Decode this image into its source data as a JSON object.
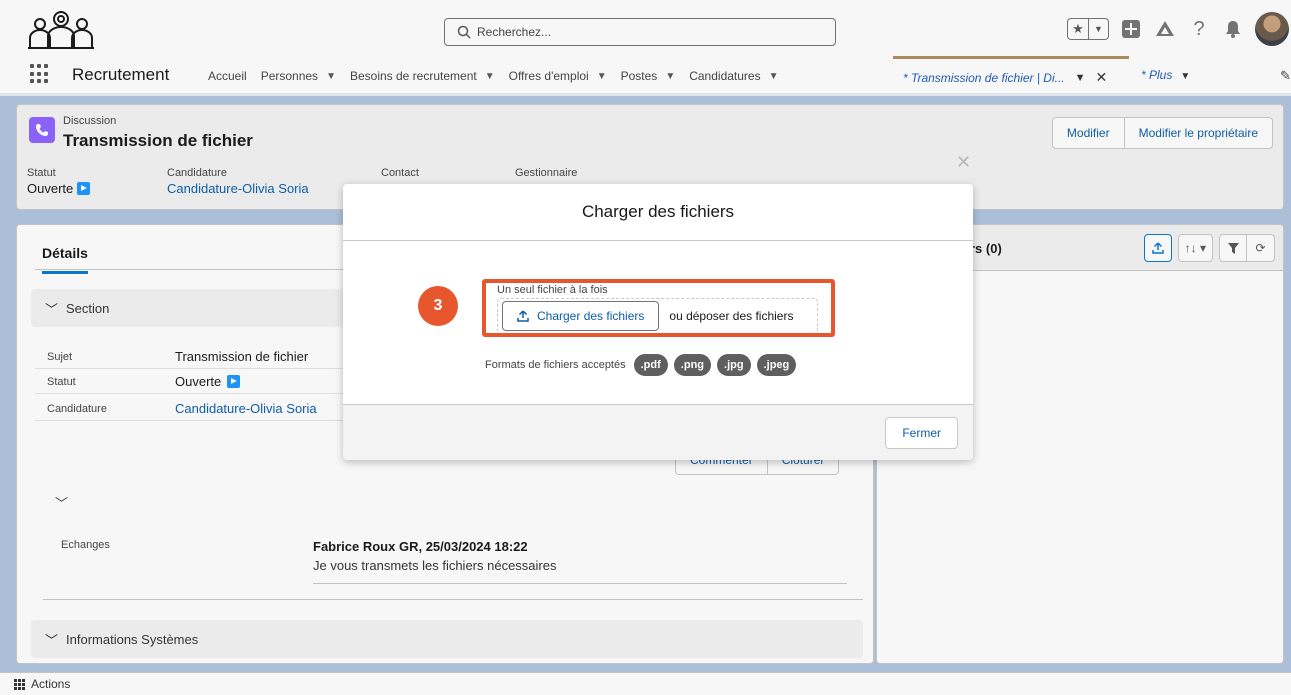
{
  "header": {
    "search_placeholder": "Recherchez..."
  },
  "nav": {
    "app_name": "Recrutement",
    "items": [
      {
        "label": "Accueil",
        "has_menu": false
      },
      {
        "label": "Personnes",
        "has_menu": true
      },
      {
        "label": "Besoins de recrutement",
        "has_menu": true
      },
      {
        "label": "Offres d'emploi",
        "has_menu": true
      },
      {
        "label": "Postes",
        "has_menu": true
      },
      {
        "label": "Candidatures",
        "has_menu": true
      }
    ],
    "active_tab": "* Transmission de fichier | Di...",
    "more": "* Plus"
  },
  "record": {
    "type": "Discussion",
    "title": "Transmission de fichier",
    "buttons": {
      "edit": "Modifier",
      "edit_owner": "Modifier le propriétaire"
    },
    "highlights": {
      "statut_label": "Statut",
      "statut_value": "Ouverte",
      "candidature_label": "Candidature",
      "candidature_value": "Candidature-Olivia Soria",
      "contact_label": "Contact",
      "gestionnaire_label": "Gestionnaire"
    }
  },
  "details": {
    "tab_label": "Détails",
    "section_label": "Section",
    "fields": [
      {
        "label": "Sujet",
        "value": "Transmission de fichier"
      },
      {
        "label": "Statut",
        "value": "Ouverte"
      },
      {
        "label": "Candidature",
        "value": "Candidature-Olivia Soria"
      }
    ],
    "actions": {
      "comment": "Commenter",
      "close": "Clôturer"
    },
    "echanges_label": "Echanges",
    "message_author": "Fabrice Roux GR, 25/03/2024 18:22",
    "message_text": "Je vous transmets les fichiers nécessaires",
    "system_section": "Informations Systèmes"
  },
  "related": {
    "title_fragment": "rs (0)"
  },
  "modal": {
    "title": "Charger des fichiers",
    "file_label": "Un seul fichier à la fois",
    "upload_button": "Charger des fichiers",
    "drop_text": "ou déposer des fichiers",
    "formats_label": "Formats de fichiers acceptés",
    "formats": [
      ".pdf",
      ".png",
      ".jpg",
      ".jpeg"
    ],
    "close_button": "Fermer",
    "step_number": "3",
    "highlight_color": "#e8562d"
  },
  "utility_bar": {
    "actions_label": "Actions"
  },
  "colors": {
    "brand_blue": "#0176d3",
    "link_blue": "#0b5cab",
    "record_icon": "#8e62ff",
    "background": "#b0c4df"
  }
}
